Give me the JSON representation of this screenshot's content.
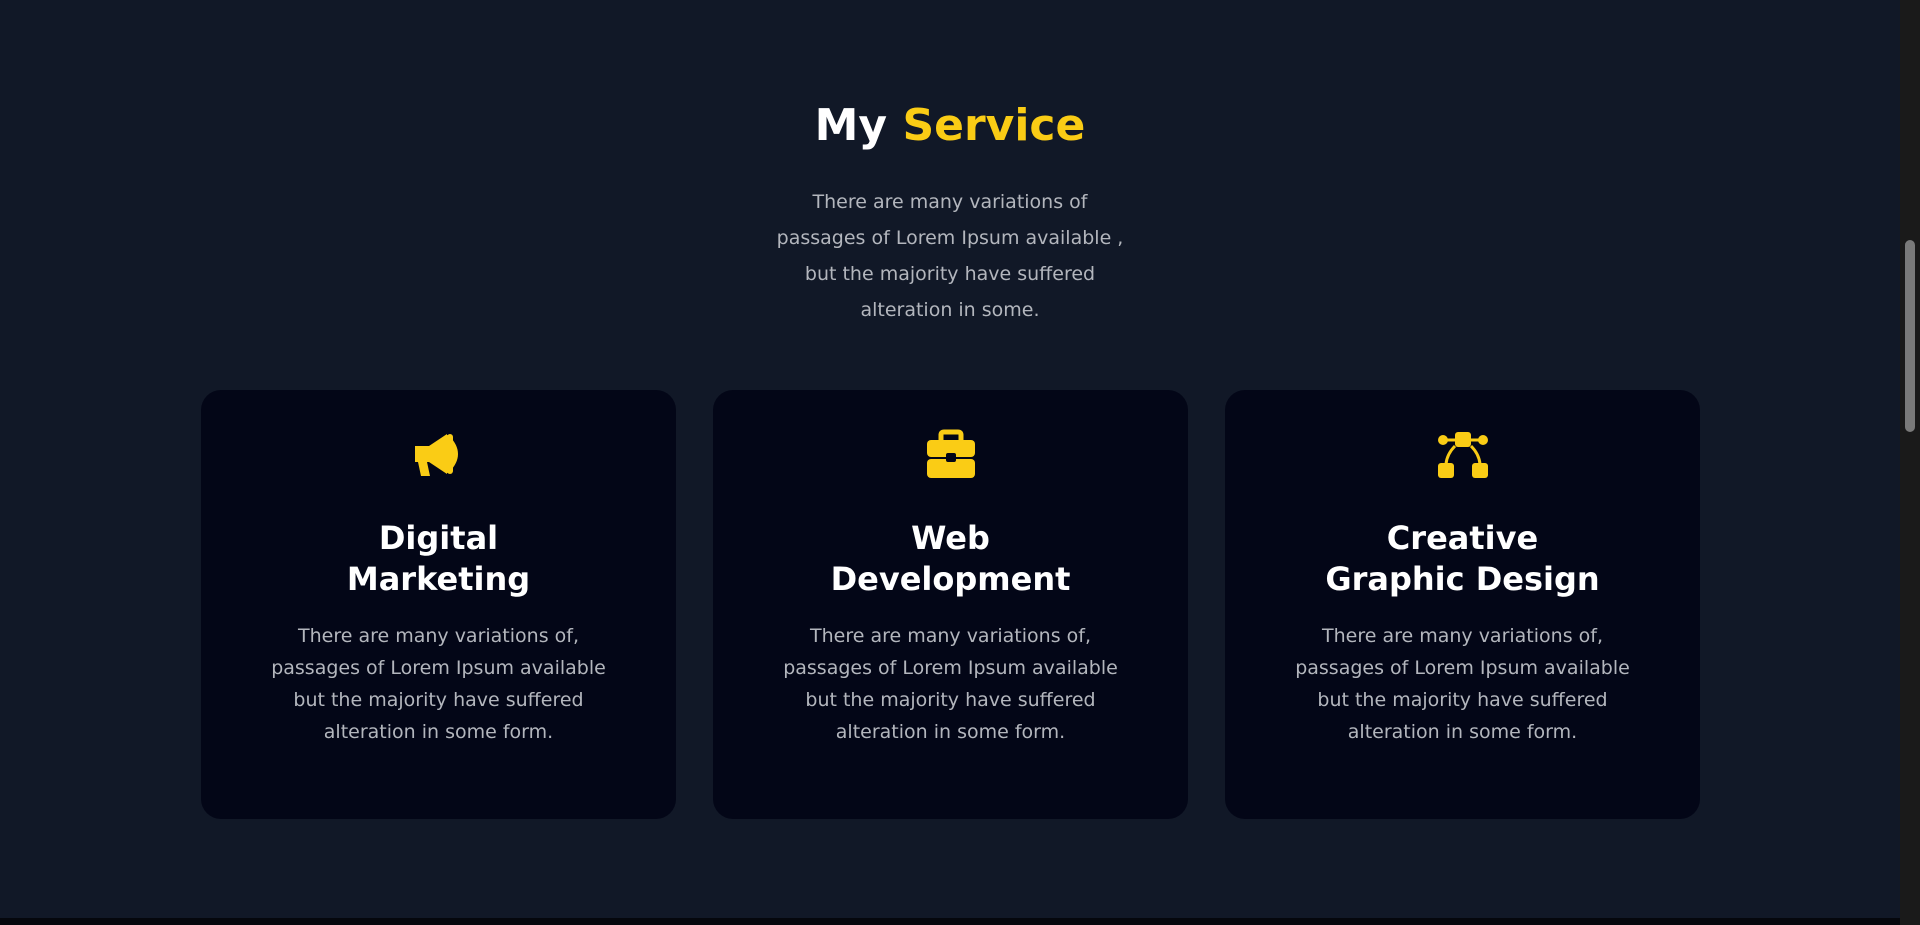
{
  "section": {
    "heading_plain": "My",
    "heading_accent": "Service",
    "intro": "There are many variations of passages of Lorem Ipsum available , but the majority have suffered alteration in some."
  },
  "services": [
    {
      "icon": "megaphone-icon",
      "title_line1": "Digital",
      "title_line2": "Marketing",
      "description": "There are many variations of, passages of Lorem Ipsum available but the majority have suffered alteration in some form."
    },
    {
      "icon": "briefcase-icon",
      "title_line1": "Web",
      "title_line2": "Development",
      "description": "There are many variations of, passages of Lorem Ipsum available but the majority have suffered alteration in some form."
    },
    {
      "icon": "vector-pen-icon",
      "title_line1": "Creative",
      "title_line2": "Graphic Design",
      "description": "There are many variations of, passages of Lorem Ipsum available but the majority have suffered alteration in some form."
    }
  ],
  "colors": {
    "background": "#111827",
    "card": "#030617",
    "accent": "#FACC15",
    "text": "#ffffff",
    "muted": "#b3b6bd"
  }
}
